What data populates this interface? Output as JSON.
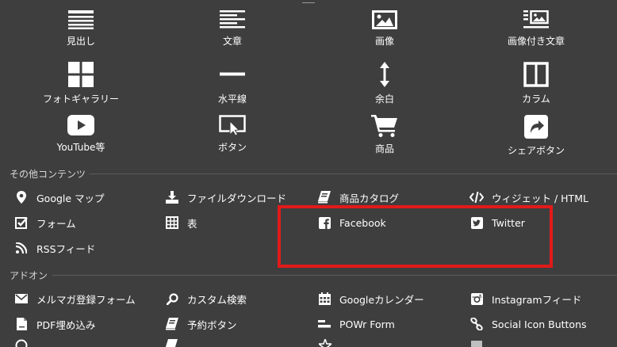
{
  "blocks": [
    {
      "label": "見出し",
      "icon": "heading-icon"
    },
    {
      "label": "文章",
      "icon": "text-icon"
    },
    {
      "label": "画像",
      "icon": "image-icon"
    },
    {
      "label": "画像付き文章",
      "icon": "image-text-icon"
    },
    {
      "label": "フォトギャラリー",
      "icon": "gallery-icon"
    },
    {
      "label": "水平線",
      "icon": "horizontal-line-icon"
    },
    {
      "label": "余白",
      "icon": "spacing-icon"
    },
    {
      "label": "カラム",
      "icon": "columns-icon"
    },
    {
      "label": "YouTube等",
      "icon": "youtube-icon"
    },
    {
      "label": "ボタン",
      "icon": "button-icon"
    },
    {
      "label": "商品",
      "icon": "cart-icon"
    },
    {
      "label": "シェアボタン",
      "icon": "share-icon"
    }
  ],
  "other_contents": {
    "title": "その他コンテンツ",
    "items": [
      {
        "label": "Google マップ",
        "icon": "map-pin-icon"
      },
      {
        "label": "ファイルダウンロード",
        "icon": "download-icon"
      },
      {
        "label": "商品カタログ",
        "icon": "catalog-icon"
      },
      {
        "label": "ウィジェット / HTML",
        "icon": "code-icon"
      },
      {
        "label": "フォーム",
        "icon": "form-check-icon"
      },
      {
        "label": "表",
        "icon": "table-icon"
      },
      {
        "label": "Facebook",
        "icon": "facebook-icon"
      },
      {
        "label": "Twitter",
        "icon": "twitter-icon"
      },
      {
        "label": "RSSフィード",
        "icon": "rss-icon"
      }
    ]
  },
  "addons": {
    "title": "アドオン",
    "items": [
      {
        "label": "メルマガ登録フォーム",
        "icon": "mail-icon"
      },
      {
        "label": "カスタム検索",
        "icon": "search-icon"
      },
      {
        "label": "Googleカレンダー",
        "icon": "calendar-icon"
      },
      {
        "label": "Instagramフィード",
        "icon": "instagram-icon"
      },
      {
        "label": "PDF埋め込み",
        "icon": "pdf-icon"
      },
      {
        "label": "予約ボタン",
        "icon": "reservation-icon"
      },
      {
        "label": "POWr Form",
        "icon": "powr-form-icon"
      },
      {
        "label": "Social Icon Buttons",
        "icon": "link-icon"
      }
    ]
  },
  "highlight_color": "#e11a1a"
}
